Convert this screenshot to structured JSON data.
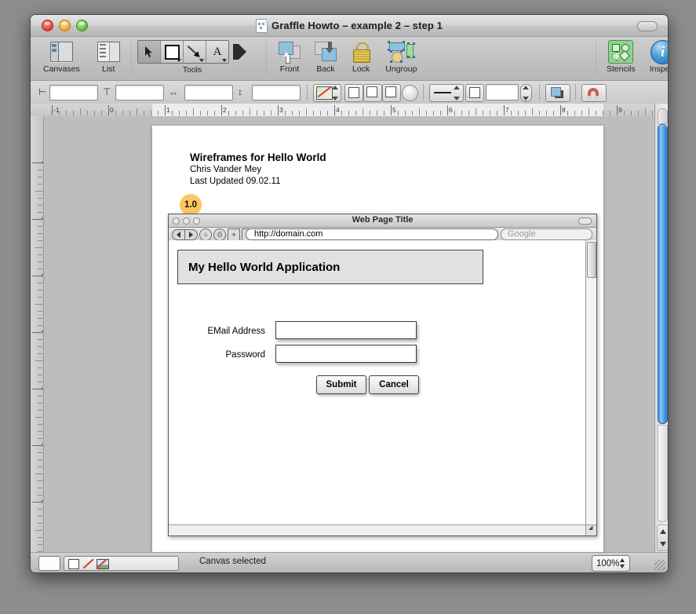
{
  "window": {
    "title": "Graffle Howto – example 2 – step 1",
    "doc_icon": "omnigraffle-document-icon",
    "traffic_lights": [
      "close-button",
      "minimize-button",
      "zoom-button"
    ],
    "toolbar_pill": "toolbar-toggle-button"
  },
  "toolbar": {
    "items": [
      {
        "label": "Canvases",
        "icon": "canvases-icon"
      },
      {
        "label": "List",
        "icon": "list-icon"
      },
      {
        "label": "Tools",
        "icon": "tools-palette"
      },
      {
        "label": "Front",
        "icon": "bring-to-front-icon"
      },
      {
        "label": "Back",
        "icon": "send-to-back-icon"
      },
      {
        "label": "Lock",
        "icon": "lock-icon"
      },
      {
        "label": "Ungroup",
        "icon": "ungroup-icon"
      },
      {
        "label": "Stencils",
        "icon": "stencils-icon"
      },
      {
        "label": "Inspect",
        "icon": "inspector-info-icon"
      }
    ],
    "tools": [
      {
        "name": "selection-tool",
        "glyph": "arrow-cursor-icon"
      },
      {
        "name": "shape-tool",
        "glyph": "square-icon"
      },
      {
        "name": "line-tool",
        "glyph": "diagonal-line-icon"
      },
      {
        "name": "text-tool",
        "glyph": "letter-a-icon"
      },
      {
        "name": "shade-tool",
        "glyph": "shade-flip-icon"
      }
    ]
  },
  "subtoolbar": {
    "fields": [
      {
        "name": "x-position-field",
        "icon": "left-align-icon",
        "value": ""
      },
      {
        "name": "y-position-field",
        "icon": "top-align-icon",
        "value": ""
      },
      {
        "name": "width-field",
        "icon": "width-arrows-icon",
        "value": ""
      },
      {
        "name": "height-field",
        "icon": "height-arrows-icon",
        "value": ""
      }
    ],
    "buttons": [
      {
        "name": "fill-style-button",
        "icon": "fill-gradient-icon"
      },
      {
        "name": "shadow-none-button",
        "icon": "shadow-none-icon"
      },
      {
        "name": "shadow-offset-button",
        "icon": "shadow-offset-icon"
      },
      {
        "name": "shadow-soft-button",
        "icon": "shadow-soft-icon"
      },
      {
        "name": "shadow-angle-dial",
        "icon": "shadow-angle-icon"
      },
      {
        "name": "stroke-width-button",
        "icon": "stroke-line-icon"
      },
      {
        "name": "corner-radius-button",
        "icon": "corner-radius-icon"
      },
      {
        "name": "stroke-value-field",
        "value": ""
      },
      {
        "name": "group-button",
        "icon": "group-squares-icon"
      },
      {
        "name": "magnets-button",
        "icon": "magnet-icon"
      }
    ]
  },
  "rulers": {
    "horizontal_labels": [
      "-1",
      "0",
      "1",
      "2",
      "3",
      "4",
      "5",
      "6",
      "7",
      "8",
      "9"
    ],
    "vertical_labels": [
      "1",
      "2",
      "3",
      "4",
      "5",
      "6",
      "7"
    ],
    "origin_marker": "ruler-origin-crosshair"
  },
  "canvas": {
    "wireframe": {
      "title": "Wireframes for Hello World",
      "author": "Chris Vander Mey",
      "date": "Last Updated 09.02.11",
      "badge": "1.0"
    },
    "browser": {
      "page_title": "Web Page Title",
      "url": "http://domain.com",
      "search_placeholder": "Google",
      "nav_icons": [
        "back-arrow-icon",
        "forward-arrow-icon",
        "home-icon",
        "print-icon",
        "add-bookmark-icon",
        "bookmark-icon"
      ],
      "app_heading": "My Hello World Application",
      "form": {
        "fields": [
          {
            "label": "EMail Address",
            "value": "",
            "name": "email-field"
          },
          {
            "label": "Password",
            "value": "",
            "name": "password-field"
          }
        ],
        "buttons": [
          {
            "label": "Submit",
            "name": "submit-button"
          },
          {
            "label": "Cancel",
            "name": "cancel-button"
          }
        ]
      }
    }
  },
  "statusbar": {
    "message": "Canvas selected",
    "zoom": "100%",
    "fill_swatch": "fill-color-swatch",
    "stroke_icons": [
      "no-fill-icon",
      "no-image-icon"
    ]
  },
  "colors": {
    "badge": "#fcc761",
    "scrollbar_thumb": "#3f8fde",
    "stencils_green": "#8fd28f",
    "inspect_blue": "#4a9fdd"
  }
}
